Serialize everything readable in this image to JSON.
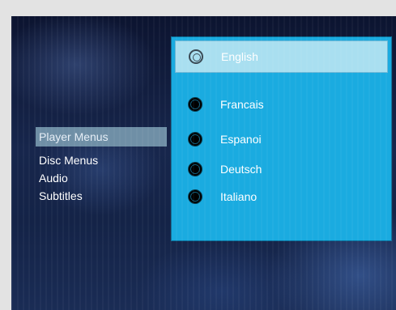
{
  "left_menu": {
    "items": [
      {
        "label": "Player Menus",
        "selected": true
      },
      {
        "label": "Disc Menus",
        "selected": false
      },
      {
        "label": "Audio",
        "selected": false
      },
      {
        "label": "Subtitles",
        "selected": false
      }
    ]
  },
  "language_panel": {
    "options": [
      {
        "label": "English",
        "highlighted": true
      },
      {
        "label": "Francais"
      },
      {
        "label": "Espanoi"
      },
      {
        "label": "Deutsch"
      },
      {
        "label": "Italiano"
      }
    ]
  },
  "colors": {
    "panel": "#1aabe0",
    "highlight": "#a9dff0",
    "menu_selected": "#6f8fa6"
  }
}
